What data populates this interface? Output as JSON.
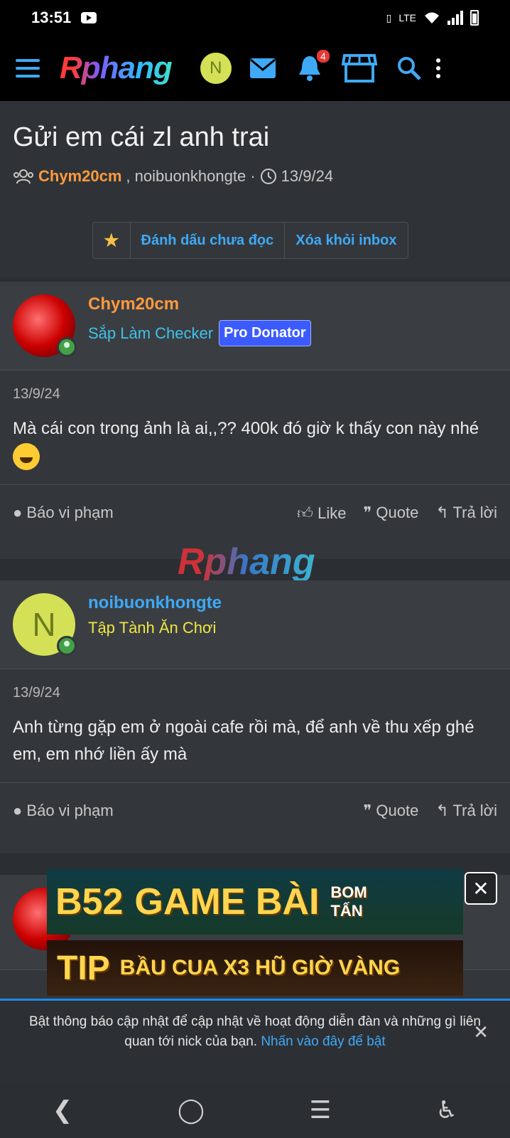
{
  "status": {
    "time": "13:51"
  },
  "nav": {
    "logo": "Rphang",
    "avatar_letter": "N",
    "notif_count": "4"
  },
  "thread": {
    "title": "Gửi em cái zl anh trai",
    "author": "Chym20cm",
    "participants": ", noibuonkhongte ·",
    "date": "13/9/24",
    "action_mark_unread": "Đánh dấu chưa đọc",
    "action_remove_inbox": "Xóa khỏi inbox"
  },
  "posts": [
    {
      "username": "Chym20cm",
      "user_title": "Sắp Làm Checker",
      "badge": "Pro Donator",
      "date": "13/9/24",
      "body": "Mà cái con trong ảnh là ai,,?? 400k đó giờ k thấy con này nhé",
      "report": "Báo vi phạm",
      "like": "Like",
      "quote": "Quote",
      "reply": "Trả lời"
    },
    {
      "username": "noibuonkhongte",
      "avatar_letter": "N",
      "user_title": "Tập Tành Ăn Chơi",
      "date": "13/9/24",
      "body": "Anh từng gặp em ở ngoài cafe rồi mà, để anh về thu xếp ghé em, em nhớ liền ấy mà",
      "report": "Báo vi phạm",
      "quote": "Quote",
      "reply": "Trả lời"
    }
  ],
  "watermark": "Rphang",
  "ads": {
    "ad1_brand": "B52",
    "ad1_text": "GAME BÀI",
    "ad1_sub": "BOM TẤN",
    "ad2_brand": "TIP",
    "ad2_text": "BẦU CUA X3 HŨ GIỜ VÀNG"
  },
  "notify": {
    "text": "Bật thông báo cập nhật để cập nhật về hoạt động diễn đàn và những gì liên quan tới nick của bạn.",
    "link": "Nhấn vào đây để bật"
  },
  "colors": {
    "accent": "#3fa9f5",
    "author": "#ff9a3c",
    "title_user1": "#3fc2e8",
    "title_user2": "#f0e642",
    "donor": "#3b5bff"
  }
}
